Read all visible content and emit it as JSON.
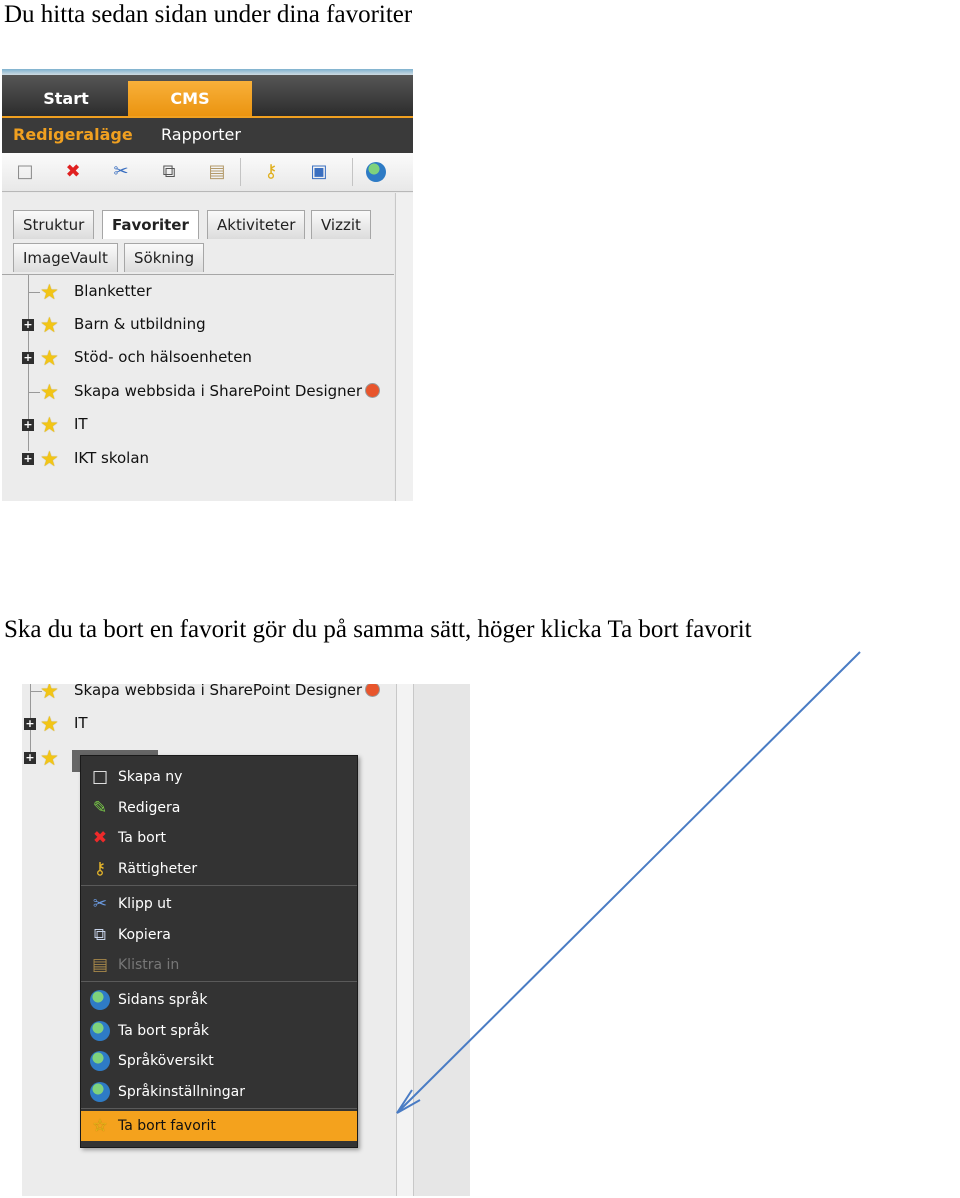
{
  "heading_1": "Du hitta sedan sidan under dina favoriter",
  "heading_2": "Ska du ta bort en favorit gör du på samma sätt, höger klicka Ta bort favorit",
  "screenshot_1": {
    "main_tabs": {
      "start": "Start",
      "cms": "CMS"
    },
    "mode_tabs": {
      "edit": "Redigeraläge",
      "reports": "Rapporter"
    },
    "toolbar_icons": [
      "new-page-icon",
      "delete-icon",
      "cut-icon",
      "copy-icon",
      "paste-icon",
      "permissions-icon",
      "translate-icon",
      "globe-icon"
    ],
    "panel_tabs": {
      "structure": "Struktur",
      "favorites": "Favoriter",
      "activities": "Aktiviteter",
      "vizzit": "Vizzit",
      "imagevault": "ImageVault",
      "search": "Sökning"
    },
    "favorites": [
      {
        "label": "Blanketter",
        "expandable": false
      },
      {
        "label": "Barn & utbildning",
        "expandable": true
      },
      {
        "label": "Stöd- och hälsoenheten",
        "expandable": true
      },
      {
        "label": "Skapa webbsida i SharePoint Designer",
        "expandable": false
      },
      {
        "label": "IT",
        "expandable": true
      },
      {
        "label": "IKT skolan",
        "expandable": true
      }
    ]
  },
  "screenshot_2": {
    "tree": [
      {
        "label": "Skapa webbsida i SharePoint Designer",
        "expandable": false
      },
      {
        "label": "IT",
        "expandable": true
      },
      {
        "label": "",
        "expandable": true
      }
    ],
    "context_menu": [
      {
        "label": "Skapa ny",
        "icon": "new-page-icon"
      },
      {
        "label": "Redigera",
        "icon": "edit-icon"
      },
      {
        "label": "Ta bort",
        "icon": "delete-icon"
      },
      {
        "label": "Rättigheter",
        "icon": "permissions-icon"
      },
      {
        "label": "Klipp ut",
        "icon": "cut-icon"
      },
      {
        "label": "Kopiera",
        "icon": "copy-icon"
      },
      {
        "label": "Klistra in",
        "icon": "paste-icon",
        "disabled": true
      },
      {
        "label": "Sidans språk",
        "icon": "page-language-icon"
      },
      {
        "label": "Ta bort språk",
        "icon": "remove-language-icon"
      },
      {
        "label": "Språköversikt",
        "icon": "language-overview-icon"
      },
      {
        "label": "Språkinställningar",
        "icon": "language-settings-icon"
      },
      {
        "label": "Ta bort favorit",
        "icon": "star-icon",
        "highlighted": true
      }
    ]
  },
  "colors": {
    "accent": "#f0a020",
    "menu_bg": "#333333",
    "arrow": "#4a7cc4"
  }
}
